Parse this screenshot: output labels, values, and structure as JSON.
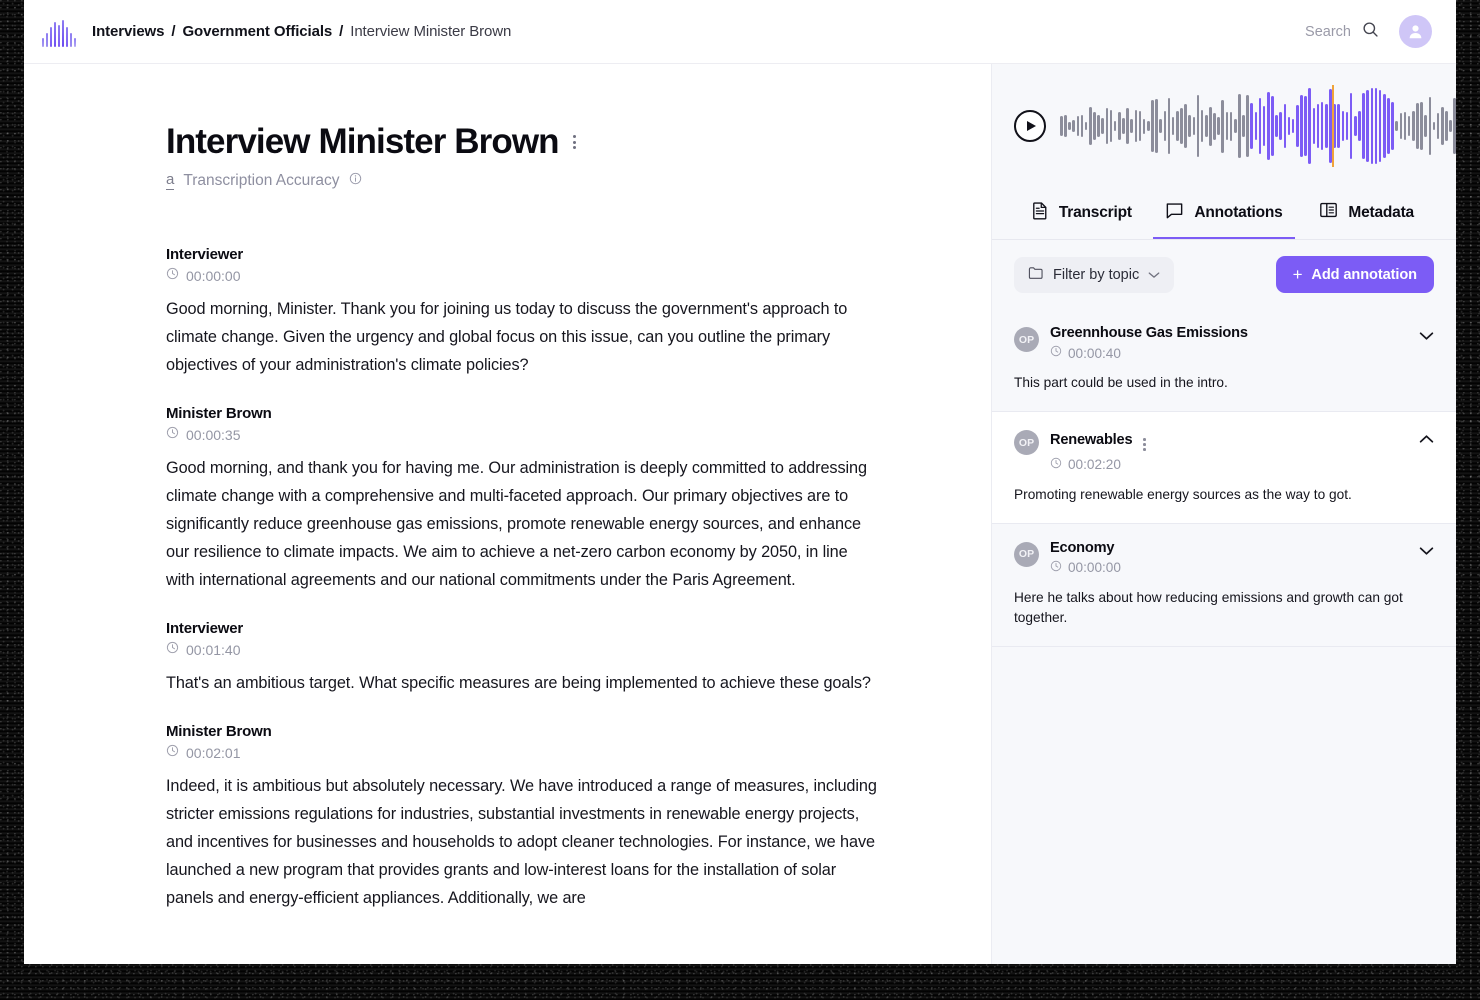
{
  "brand": {
    "logo_icon": "waveform-logo-icon",
    "accent": "#7c5cf5"
  },
  "topbar": {
    "breadcrumb": [
      {
        "label": "Interviews",
        "strong": true
      },
      {
        "label": "Government Officials",
        "strong": true
      },
      {
        "label": "Interview Minister Brown",
        "strong": false
      }
    ],
    "separator": "/",
    "search_label": "Search",
    "search_icon": "search-icon",
    "avatar_icon": "user-avatar-icon"
  },
  "document": {
    "title": "Interview Minister Brown",
    "menu_icon": "kebab-menu-icon",
    "accuracy_icon": "text-accuracy-icon",
    "accuracy_glyph": "a",
    "accuracy_label": "Transcription Accuracy",
    "info_icon": "info-circle-icon"
  },
  "transcript": {
    "clock_icon": "clock-icon",
    "segments": [
      {
        "speaker": "Interviewer",
        "time": "00:00:00",
        "text": "Good morning, Minister. Thank you for joining us today to discuss the government's approach to climate change. Given the urgency and global focus on this issue, can you outline the primary objectives of your administration's climate policies?"
      },
      {
        "speaker": "Minister Brown",
        "time": "00:00:35",
        "text": "Good morning, and thank you for having me. Our administration is deeply committed to addressing climate change with a comprehensive and multi-faceted approach. Our primary objectives are to significantly reduce greenhouse gas emissions, promote renewable energy sources, and enhance our resilience to climate impacts. We aim to achieve a net-zero carbon economy by 2050, in line with international agreements and our national commitments under the Paris Agreement."
      },
      {
        "speaker": "Interviewer",
        "time": "00:01:40",
        "text": "That's an ambitious target. What specific measures are being implemented to achieve these goals?"
      },
      {
        "speaker": "Minister Brown",
        "time": "00:02:01",
        "text": "Indeed, it is ambitious but absolutely necessary. We have introduced a range of measures, including stricter emissions regulations for industries, substantial investments in renewable energy projects, and incentives for businesses and households to adopt cleaner technologies. For instance, we have launched a new program that provides grants and low-interest loans for the installation of solar panels and energy-efficient appliances. Additionally, we are"
      }
    ]
  },
  "player": {
    "play_icon": "play-button-icon",
    "waveform_icon": "audio-waveform-icon",
    "playhead_color": "#f0a33a",
    "active_color": "#7c5cf5",
    "inactive_color": "#8c8d9b"
  },
  "tabs": [
    {
      "label": "Transcript",
      "icon": "document-icon",
      "active": false
    },
    {
      "label": "Annotations",
      "icon": "comment-bubble-icon",
      "active": true
    },
    {
      "label": "Metadata",
      "icon": "panel-layout-icon",
      "active": false
    }
  ],
  "annotations_toolbar": {
    "filter_label": "Filter by topic",
    "filter_icon": "folder-icon",
    "filter_chevron_icon": "chevron-down-icon",
    "add_label": "Add annotation",
    "add_icon": "plus-icon"
  },
  "annotations": [
    {
      "avatar_initials": "OP",
      "title": "Greennhouse Gas Emissions",
      "time": "00:00:40",
      "body": "This part could be used in the intro.",
      "expanded": false,
      "has_menu": false,
      "chevron_icon": "chevron-down-icon"
    },
    {
      "avatar_initials": "OP",
      "title": "Renewables",
      "time": "00:02:20",
      "body": "Promoting renewable energy sources as the way to got.",
      "expanded": true,
      "has_menu": true,
      "menu_icon": "kebab-menu-icon",
      "chevron_icon": "chevron-up-icon"
    },
    {
      "avatar_initials": "OP",
      "title": "Economy",
      "time": "00:00:00",
      "body": "Here he talks about how reducing emissions and growth can got together.",
      "expanded": false,
      "has_menu": false,
      "chevron_icon": "chevron-down-icon"
    }
  ]
}
